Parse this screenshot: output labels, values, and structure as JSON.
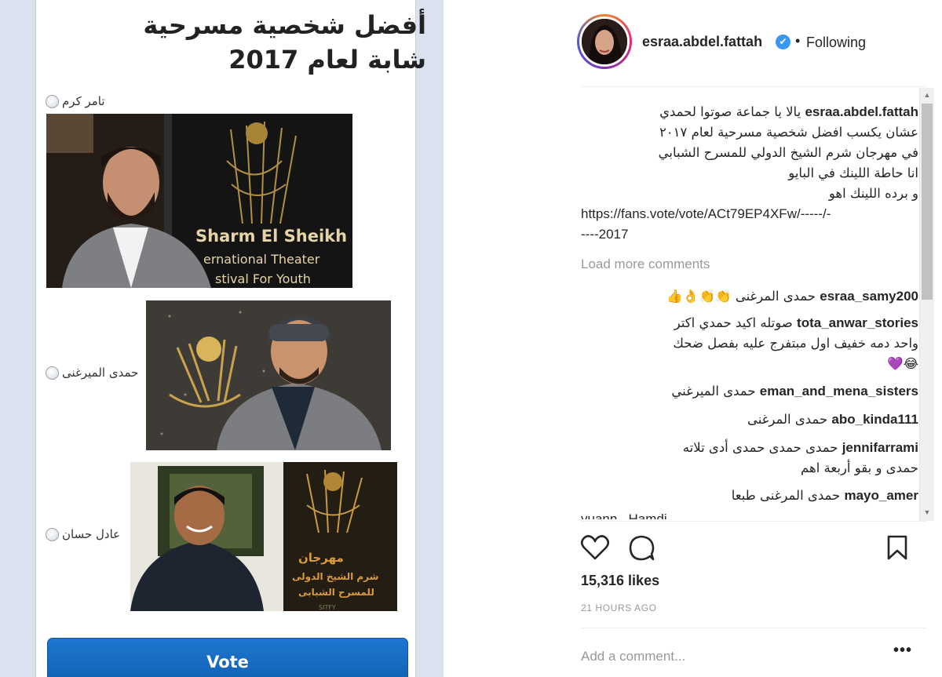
{
  "poll": {
    "title": "أفضل شخصية مسرحية شابة لعام 2017",
    "options": [
      {
        "label": "تامر كرم"
      },
      {
        "label": "حمدى الميرغنى"
      },
      {
        "label": "عادل حسان"
      }
    ],
    "photo1": {
      "banner_line1": "Sharm El Sheikh",
      "banner_line2": "ernational Theater",
      "banner_line3": "stival For Youth"
    },
    "photo3": {
      "banner_line1": "مهرجان",
      "banner_line2": "شرم الشيخ الدولى",
      "banner_line3": "للمسرح الشبابى",
      "banner_line4": "SITFY"
    },
    "vote_label": "Vote"
  },
  "header": {
    "username": "esraa.abdel.fattah",
    "verified_icon": "✔",
    "separator": "•",
    "follow_status": "Following"
  },
  "caption": {
    "username": "esraa.abdel.fattah",
    "line1": "يالا يا جماعة صوتوا لحمدي",
    "line2": "عشان يكسب افضل شخصية مسرحية لعام ٢٠١٧",
    "line3": "في مهرجان شرم الشيخ الدولي للمسرح الشبابي",
    "line4": "انا حاطة اللينك في البايو",
    "line5": "و برده اللينك اهو",
    "url_line1": "https://fans.vote/vote/ACt79EP4XFw/-----/-",
    "url_line2": "----2017"
  },
  "load_more": "Load more comments",
  "comments": [
    {
      "user": "esraa_samy200",
      "text": "حمدى المرغنى",
      "emoji": "👏👏👌👍"
    },
    {
      "user": "tota_anwar_stories",
      "text": "صوتله اكيد حمدي اكتر",
      "text2": "واحد دمه خفيف اول مبتفرج عليه بفصل ضحك",
      "emoji": "😂💜"
    },
    {
      "user": "eman_and_mena_sisters",
      "text": "حمدى الميرغني"
    },
    {
      "user": "abo_kinda111",
      "text": "حمدى المرغنى"
    },
    {
      "user": "jennifarrami",
      "text": "حمدى حمدى حمدى أدى تلاته",
      "text2": "حمدى و بقو أربعة اهم"
    },
    {
      "user": "mayo_amer",
      "text": "حمدى المرغنى طبعا"
    }
  ],
  "cut_comment": "yuann_ Hamdi",
  "actions": {
    "like": "heart-icon",
    "comment": "comment-icon",
    "save": "bookmark-icon"
  },
  "likes": "15,316 likes",
  "posted": "21 HOURS AGO",
  "add_comment_placeholder": "Add a comment...",
  "more": "•••",
  "colors": {
    "link": "#3897f0",
    "vote_button": "#1565c0",
    "verified": "#3897f0"
  }
}
